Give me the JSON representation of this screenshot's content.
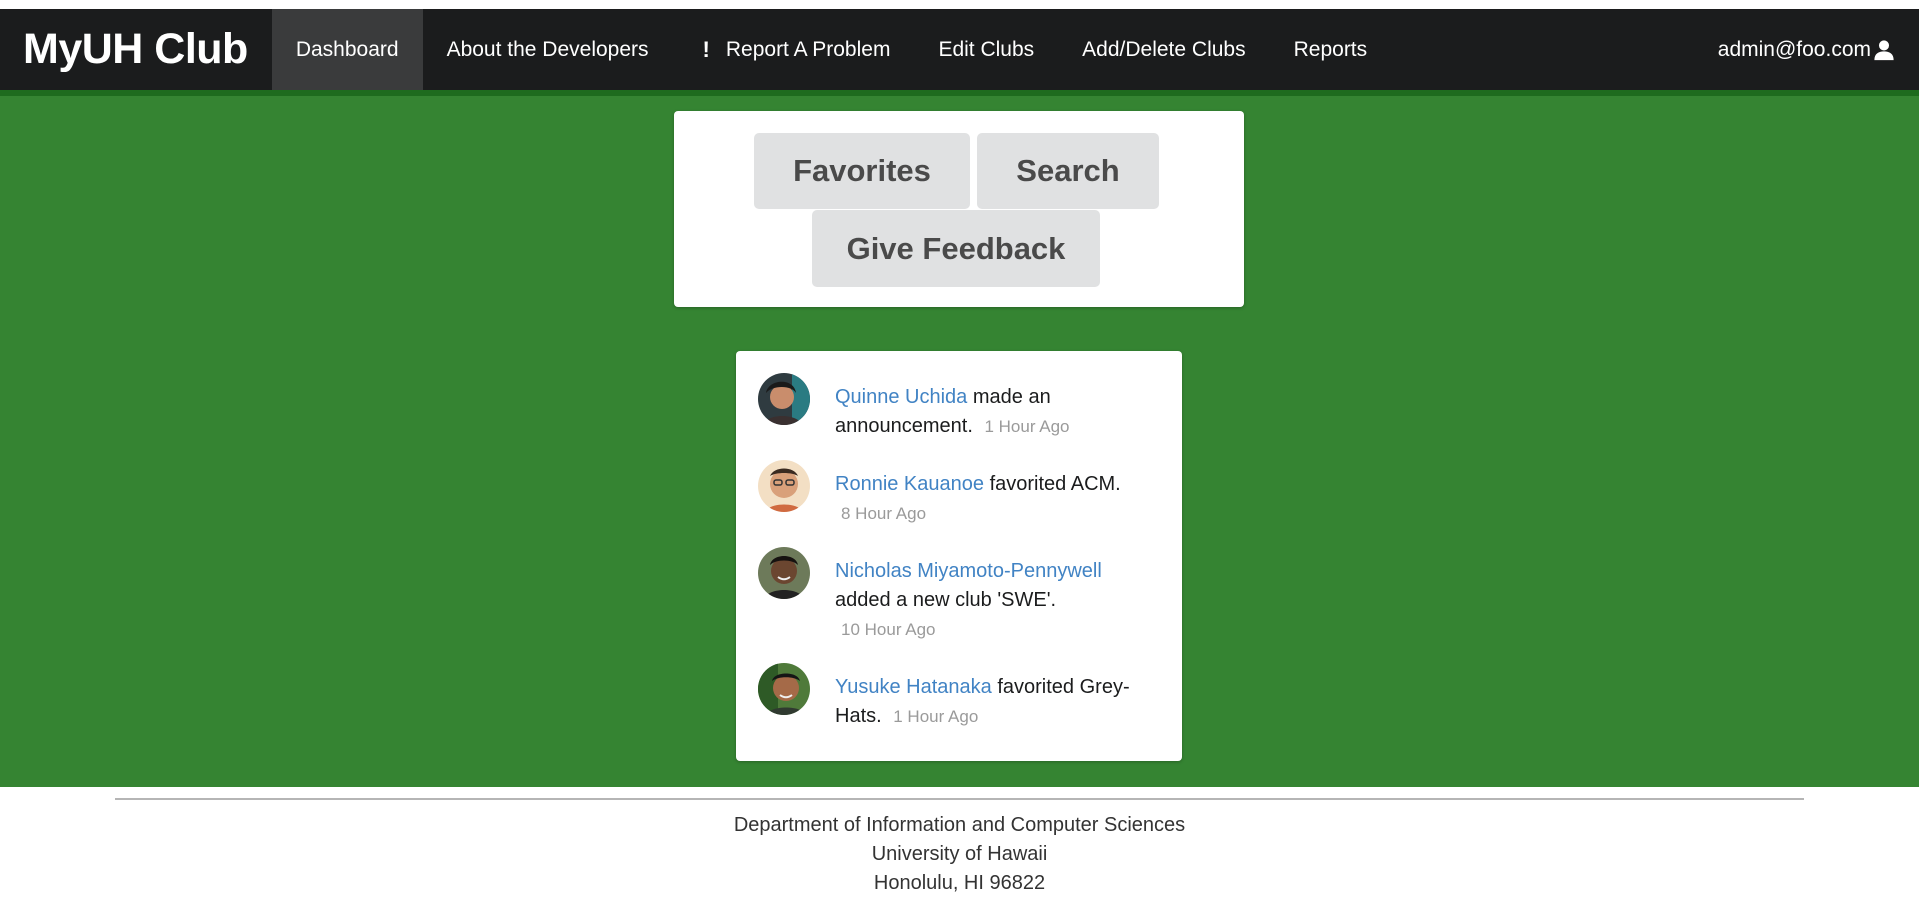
{
  "navbar": {
    "brand": "MyUH Club",
    "items": [
      {
        "label": "Dashboard",
        "active": true
      },
      {
        "label": "About the Developers"
      },
      {
        "label": "Report A Problem",
        "icon": "exclamation-icon"
      },
      {
        "label": "Edit Clubs"
      },
      {
        "label": "Add/Delete Clubs"
      },
      {
        "label": "Reports"
      }
    ],
    "user": {
      "email": "admin@foo.com",
      "icon": "user-icon"
    }
  },
  "actions": {
    "favorites": "Favorites",
    "search": "Search",
    "feedback": "Give Feedback"
  },
  "feed": [
    {
      "user": "Quinne Uchida",
      "action": "made an announcement.",
      "date": "1 Hour Ago"
    },
    {
      "user": "Ronnie Kauanoe",
      "action": "favorited ACM.",
      "date": "8 Hour Ago"
    },
    {
      "user": "Nicholas Miyamoto-Pennywell",
      "action": "added a new club 'SWE'.",
      "date": "10 Hour Ago"
    },
    {
      "user": "Yusuke Hatanaka",
      "action": "favorited Grey-Hats.",
      "date": "1 Hour Ago"
    }
  ],
  "footer": {
    "line1": "Department of Information and Computer Sciences",
    "line2": "University of Hawaii",
    "line3": "Honolulu, HI 96822"
  },
  "colors": {
    "navbar_bg": "#1b1c1d",
    "page_green": "#358432",
    "link_blue": "#4183c4",
    "button_grey": "#e0e1e2"
  }
}
